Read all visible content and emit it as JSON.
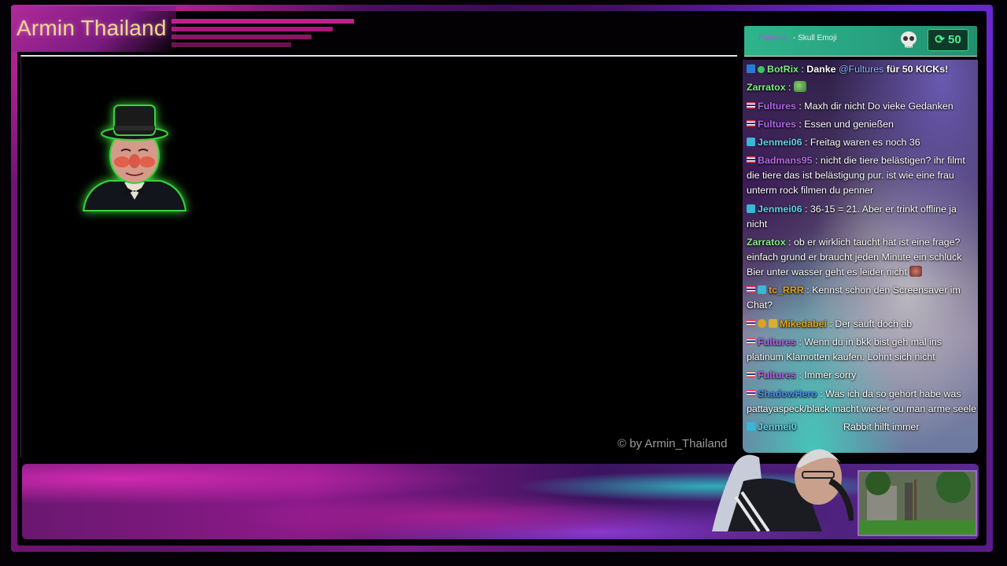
{
  "overlay": {
    "title": "Armin Thailand",
    "watermark": "© by Armin_Thailand"
  },
  "kick_alert": {
    "username": "Fultures",
    "item": "- Skull Emoji",
    "amount": "50",
    "icon": "skull-icon",
    "colors": {
      "header": "#2fb48a",
      "amount": "#4ef08a"
    }
  },
  "chat": {
    "messages": [
      {
        "badges": [
          "bot-icon",
          "verified-icon"
        ],
        "user": "BotRix",
        "user_color": "#7cf07a",
        "sep": ":",
        "pre": "Danke",
        "mention": "@Fultures",
        "text": "für 50 KICKs!",
        "bold": true
      },
      {
        "badges": [],
        "user": "Zarratox",
        "sep": ":",
        "text": "",
        "emote": "frog-emote"
      },
      {
        "badges": [
          "flag-icon"
        ],
        "user": "Fultures",
        "sep": ":",
        "text": "Maxh dir nicht Do vieke Gedanken"
      },
      {
        "badges": [
          "flag-icon"
        ],
        "user": "Fultures",
        "sep": ":",
        "text": "Essen und genießen"
      },
      {
        "badges": [
          "subscriber-icon"
        ],
        "user": "Jenmei06",
        "sep": ":",
        "text": "Freitag waren es noch 36"
      },
      {
        "badges": [
          "flag-icon"
        ],
        "user": "Badmans95",
        "sep": ":",
        "text": "nicht die tiere belästigen? ihr filmt die tiere das ist belästigung pur. ist wie eine frau unterm rock filmen du penner"
      },
      {
        "badges": [
          "subscriber-icon"
        ],
        "user": "Jenmei06",
        "sep": ":",
        "text": "36-15 = 21. Aber er trinkt offline ja nicht"
      },
      {
        "badges": [],
        "user": "Zarratox",
        "sep": ":",
        "text": "ob er wirklich taucht hat ist eine frage? einfach grund er braucht jeden Minute ein schluck Bier unter wasser geht es leider nicht",
        "emote": "face-emote"
      },
      {
        "badges": [
          "flag-icon",
          "subscriber-icon"
        ],
        "user": "tc_RRR",
        "sep": ":",
        "text": "Kennst schon den Screensaver im Chat?"
      },
      {
        "badges": [
          "flag-icon",
          "coin-icon",
          "gift-icon"
        ],
        "user": "Mikedabei",
        "sep": ":",
        "text": "Der säuft doch ab"
      },
      {
        "badges": [
          "flag-icon"
        ],
        "user": "Fultures",
        "sep": ":",
        "text": "Wenn du in bkk bist geh mal ins platinum Klamotten kaufen. Lohnt sich nicht"
      },
      {
        "badges": [
          "flag-icon"
        ],
        "user": "Fultures",
        "sep": ":",
        "text": "Immer sorry"
      },
      {
        "badges": [
          "flag-icon"
        ],
        "user": "ShadowHero",
        "sep": ":",
        "text": "Was ich da so gehört habe was pattayaspeck/black macht wieder ou man arme seele"
      },
      {
        "badges": [
          "subscriber-icon"
        ],
        "user": "Jenmei0",
        "sep": "",
        "text": "Rabbit hilft immer"
      }
    ]
  },
  "decor": {
    "avatar": "top-hat-man-avatar",
    "webcam": "streamer-webcam",
    "scene": "garden-preview"
  }
}
